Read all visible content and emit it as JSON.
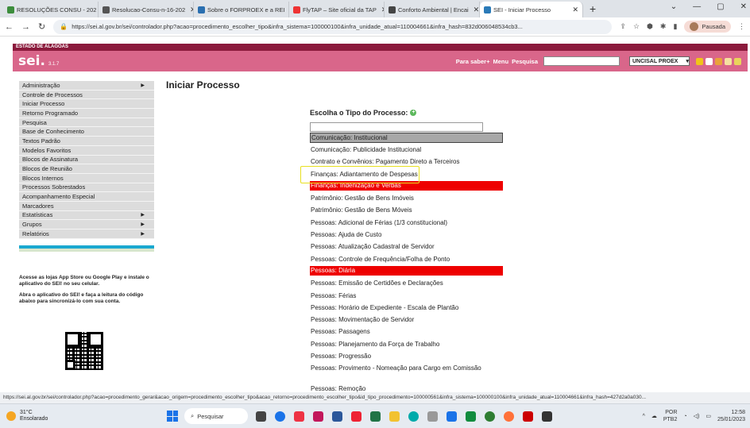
{
  "browser": {
    "tabs": [
      {
        "label": "RESOLUÇÕES CONSU - 202",
        "color": "#3c8d3c"
      },
      {
        "label": "Resolucao-Consu-n-16-202",
        "color": "#555"
      },
      {
        "label": "Sobre o FORPROEX e a REI",
        "color": "#2a6fb0"
      },
      {
        "label": "FlyTAP – Site oficial da TAP",
        "color": "#e33"
      },
      {
        "label": "Conforto Ambiental | Encai",
        "color": "#444"
      },
      {
        "label": "SEI - Iniciar Processo",
        "color": "#2a7ab8"
      }
    ],
    "url": "https://sei.al.gov.br/sei/controlador.php?acao=procedimento_escolher_tipo&infra_sistema=100000100&infra_unidade_atual=110004661&infra_hash=832d006048534cb3...",
    "profile_label": "Pausada"
  },
  "sei": {
    "estado_label": "ESTADO DE ALAGOAS",
    "logo": "sei.",
    "version": "3.1.7",
    "link_para_saber": "Para saber+",
    "link_menu": "Menu",
    "link_pesquisa": "Pesquisa",
    "unit": "UNCISAL PROEX",
    "menu": [
      {
        "label": "Administração",
        "arrow": true
      },
      {
        "label": "Controle de Processos",
        "arrow": false
      },
      {
        "label": "Iniciar Processo",
        "arrow": false
      },
      {
        "label": "Retorno Programado",
        "arrow": false
      },
      {
        "label": "Pesquisa",
        "arrow": false
      },
      {
        "label": "Base de Conhecimento",
        "arrow": false
      },
      {
        "label": "Textos Padrão",
        "arrow": false
      },
      {
        "label": "Modelos Favoritos",
        "arrow": false
      },
      {
        "label": "Blocos de Assinatura",
        "arrow": false
      },
      {
        "label": "Blocos de Reunião",
        "arrow": false
      },
      {
        "label": "Blocos Internos",
        "arrow": false
      },
      {
        "label": "Processos Sobrestados",
        "arrow": false
      },
      {
        "label": "Acompanhamento Especial",
        "arrow": false
      },
      {
        "label": "Marcadores",
        "arrow": false
      },
      {
        "label": "Estatísticas",
        "arrow": true
      },
      {
        "label": "Grupos",
        "arrow": true
      },
      {
        "label": "Relatórios",
        "arrow": true
      }
    ],
    "app_text_1": "Acesse as lojas App Store ou Google Play e instale o aplicativo do SEI! no seu celular.",
    "app_text_2": "Abra o aplicativo do SEI! e faça a leitura do código abaixo para sincronizá-lo com sua conta.",
    "page_title": "Iniciar Processo",
    "choose_label": "Escolha o Tipo do Processo:",
    "processes": [
      {
        "label": "Comunicação: Institucional",
        "style": "sel"
      },
      {
        "label": "Comunicação: Publicidade Institucional",
        "style": ""
      },
      {
        "label": "Contrato e Convênios: Pagamento Direto a Terceiros",
        "style": ""
      },
      {
        "label": "Finanças: Adiantamento de Despesas",
        "style": ""
      },
      {
        "label": "Finanças: Indenização e Verbas",
        "style": "red"
      },
      {
        "label": "Patrimônio: Gestão de Bens Imóveis",
        "style": ""
      },
      {
        "label": "Patrimônio: Gestão de Bens Móveis",
        "style": ""
      },
      {
        "label": "Pessoas: Adicional de Férias (1/3 constitucional)",
        "style": ""
      },
      {
        "label": "Pessoas: Ajuda de Custo",
        "style": ""
      },
      {
        "label": "Pessoas: Atualização Cadastral de Servidor",
        "style": ""
      },
      {
        "label": "Pessoas: Controle de Frequência/Folha de Ponto",
        "style": ""
      },
      {
        "label": "Pessoas: Diária",
        "style": "red"
      },
      {
        "label": "Pessoas: Emissão de Certidões e Declarações",
        "style": ""
      },
      {
        "label": "Pessoas: Férias",
        "style": ""
      },
      {
        "label": "Pessoas: Horário de Expediente - Escala de Plantão",
        "style": ""
      },
      {
        "label": "Pessoas: Movimentação de Servidor",
        "style": ""
      },
      {
        "label": "Pessoas: Passagens",
        "style": ""
      },
      {
        "label": "Pessoas: Planejamento da Força de Trabalho",
        "style": ""
      },
      {
        "label": "Pessoas: Progressão",
        "style": ""
      },
      {
        "label": "Pessoas: Provimento - Nomeação para Cargo em Comissão",
        "style": "two"
      },
      {
        "label": "Pessoas: Remoção",
        "style": ""
      }
    ]
  },
  "status_url": "https://sei.al.gov.br/sei/controlador.php?acao=procedimento_gerar&acao_origem=procedimento_escolher_tipo&acao_retorno=procedimento_escolher_tipo&id_tipo_procedimento=100000561&infra_sistema=100000100&infra_unidade_atual=110004661&infra_hash=427d2a0a030...",
  "taskbar": {
    "temp": "31°C",
    "weather": "Ensolarado",
    "search": "Pesquisar",
    "lang1": "POR",
    "lang2": "PTB2",
    "time": "12:58",
    "date": "25/01/2023"
  },
  "colors": {
    "sei_header": "#d9668a",
    "estado_bar": "#8b1a3c",
    "highlight_red": "#ee0000"
  }
}
